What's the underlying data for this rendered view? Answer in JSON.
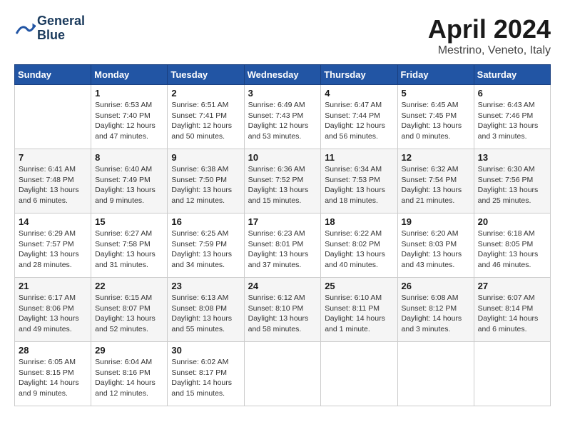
{
  "header": {
    "logo_line1": "General",
    "logo_line2": "Blue",
    "month_title": "April 2024",
    "location": "Mestrino, Veneto, Italy"
  },
  "calendar": {
    "days_of_week": [
      "Sunday",
      "Monday",
      "Tuesday",
      "Wednesday",
      "Thursday",
      "Friday",
      "Saturday"
    ],
    "weeks": [
      [
        {
          "day": "",
          "info": ""
        },
        {
          "day": "1",
          "info": "Sunrise: 6:53 AM\nSunset: 7:40 PM\nDaylight: 12 hours\nand 47 minutes."
        },
        {
          "day": "2",
          "info": "Sunrise: 6:51 AM\nSunset: 7:41 PM\nDaylight: 12 hours\nand 50 minutes."
        },
        {
          "day": "3",
          "info": "Sunrise: 6:49 AM\nSunset: 7:43 PM\nDaylight: 12 hours\nand 53 minutes."
        },
        {
          "day": "4",
          "info": "Sunrise: 6:47 AM\nSunset: 7:44 PM\nDaylight: 12 hours\nand 56 minutes."
        },
        {
          "day": "5",
          "info": "Sunrise: 6:45 AM\nSunset: 7:45 PM\nDaylight: 13 hours\nand 0 minutes."
        },
        {
          "day": "6",
          "info": "Sunrise: 6:43 AM\nSunset: 7:46 PM\nDaylight: 13 hours\nand 3 minutes."
        }
      ],
      [
        {
          "day": "7",
          "info": "Sunrise: 6:41 AM\nSunset: 7:48 PM\nDaylight: 13 hours\nand 6 minutes."
        },
        {
          "day": "8",
          "info": "Sunrise: 6:40 AM\nSunset: 7:49 PM\nDaylight: 13 hours\nand 9 minutes."
        },
        {
          "day": "9",
          "info": "Sunrise: 6:38 AM\nSunset: 7:50 PM\nDaylight: 13 hours\nand 12 minutes."
        },
        {
          "day": "10",
          "info": "Sunrise: 6:36 AM\nSunset: 7:52 PM\nDaylight: 13 hours\nand 15 minutes."
        },
        {
          "day": "11",
          "info": "Sunrise: 6:34 AM\nSunset: 7:53 PM\nDaylight: 13 hours\nand 18 minutes."
        },
        {
          "day": "12",
          "info": "Sunrise: 6:32 AM\nSunset: 7:54 PM\nDaylight: 13 hours\nand 21 minutes."
        },
        {
          "day": "13",
          "info": "Sunrise: 6:30 AM\nSunset: 7:56 PM\nDaylight: 13 hours\nand 25 minutes."
        }
      ],
      [
        {
          "day": "14",
          "info": "Sunrise: 6:29 AM\nSunset: 7:57 PM\nDaylight: 13 hours\nand 28 minutes."
        },
        {
          "day": "15",
          "info": "Sunrise: 6:27 AM\nSunset: 7:58 PM\nDaylight: 13 hours\nand 31 minutes."
        },
        {
          "day": "16",
          "info": "Sunrise: 6:25 AM\nSunset: 7:59 PM\nDaylight: 13 hours\nand 34 minutes."
        },
        {
          "day": "17",
          "info": "Sunrise: 6:23 AM\nSunset: 8:01 PM\nDaylight: 13 hours\nand 37 minutes."
        },
        {
          "day": "18",
          "info": "Sunrise: 6:22 AM\nSunset: 8:02 PM\nDaylight: 13 hours\nand 40 minutes."
        },
        {
          "day": "19",
          "info": "Sunrise: 6:20 AM\nSunset: 8:03 PM\nDaylight: 13 hours\nand 43 minutes."
        },
        {
          "day": "20",
          "info": "Sunrise: 6:18 AM\nSunset: 8:05 PM\nDaylight: 13 hours\nand 46 minutes."
        }
      ],
      [
        {
          "day": "21",
          "info": "Sunrise: 6:17 AM\nSunset: 8:06 PM\nDaylight: 13 hours\nand 49 minutes."
        },
        {
          "day": "22",
          "info": "Sunrise: 6:15 AM\nSunset: 8:07 PM\nDaylight: 13 hours\nand 52 minutes."
        },
        {
          "day": "23",
          "info": "Sunrise: 6:13 AM\nSunset: 8:08 PM\nDaylight: 13 hours\nand 55 minutes."
        },
        {
          "day": "24",
          "info": "Sunrise: 6:12 AM\nSunset: 8:10 PM\nDaylight: 13 hours\nand 58 minutes."
        },
        {
          "day": "25",
          "info": "Sunrise: 6:10 AM\nSunset: 8:11 PM\nDaylight: 14 hours\nand 1 minute."
        },
        {
          "day": "26",
          "info": "Sunrise: 6:08 AM\nSunset: 8:12 PM\nDaylight: 14 hours\nand 3 minutes."
        },
        {
          "day": "27",
          "info": "Sunrise: 6:07 AM\nSunset: 8:14 PM\nDaylight: 14 hours\nand 6 minutes."
        }
      ],
      [
        {
          "day": "28",
          "info": "Sunrise: 6:05 AM\nSunset: 8:15 PM\nDaylight: 14 hours\nand 9 minutes."
        },
        {
          "day": "29",
          "info": "Sunrise: 6:04 AM\nSunset: 8:16 PM\nDaylight: 14 hours\nand 12 minutes."
        },
        {
          "day": "30",
          "info": "Sunrise: 6:02 AM\nSunset: 8:17 PM\nDaylight: 14 hours\nand 15 minutes."
        },
        {
          "day": "",
          "info": ""
        },
        {
          "day": "",
          "info": ""
        },
        {
          "day": "",
          "info": ""
        },
        {
          "day": "",
          "info": ""
        }
      ]
    ]
  }
}
